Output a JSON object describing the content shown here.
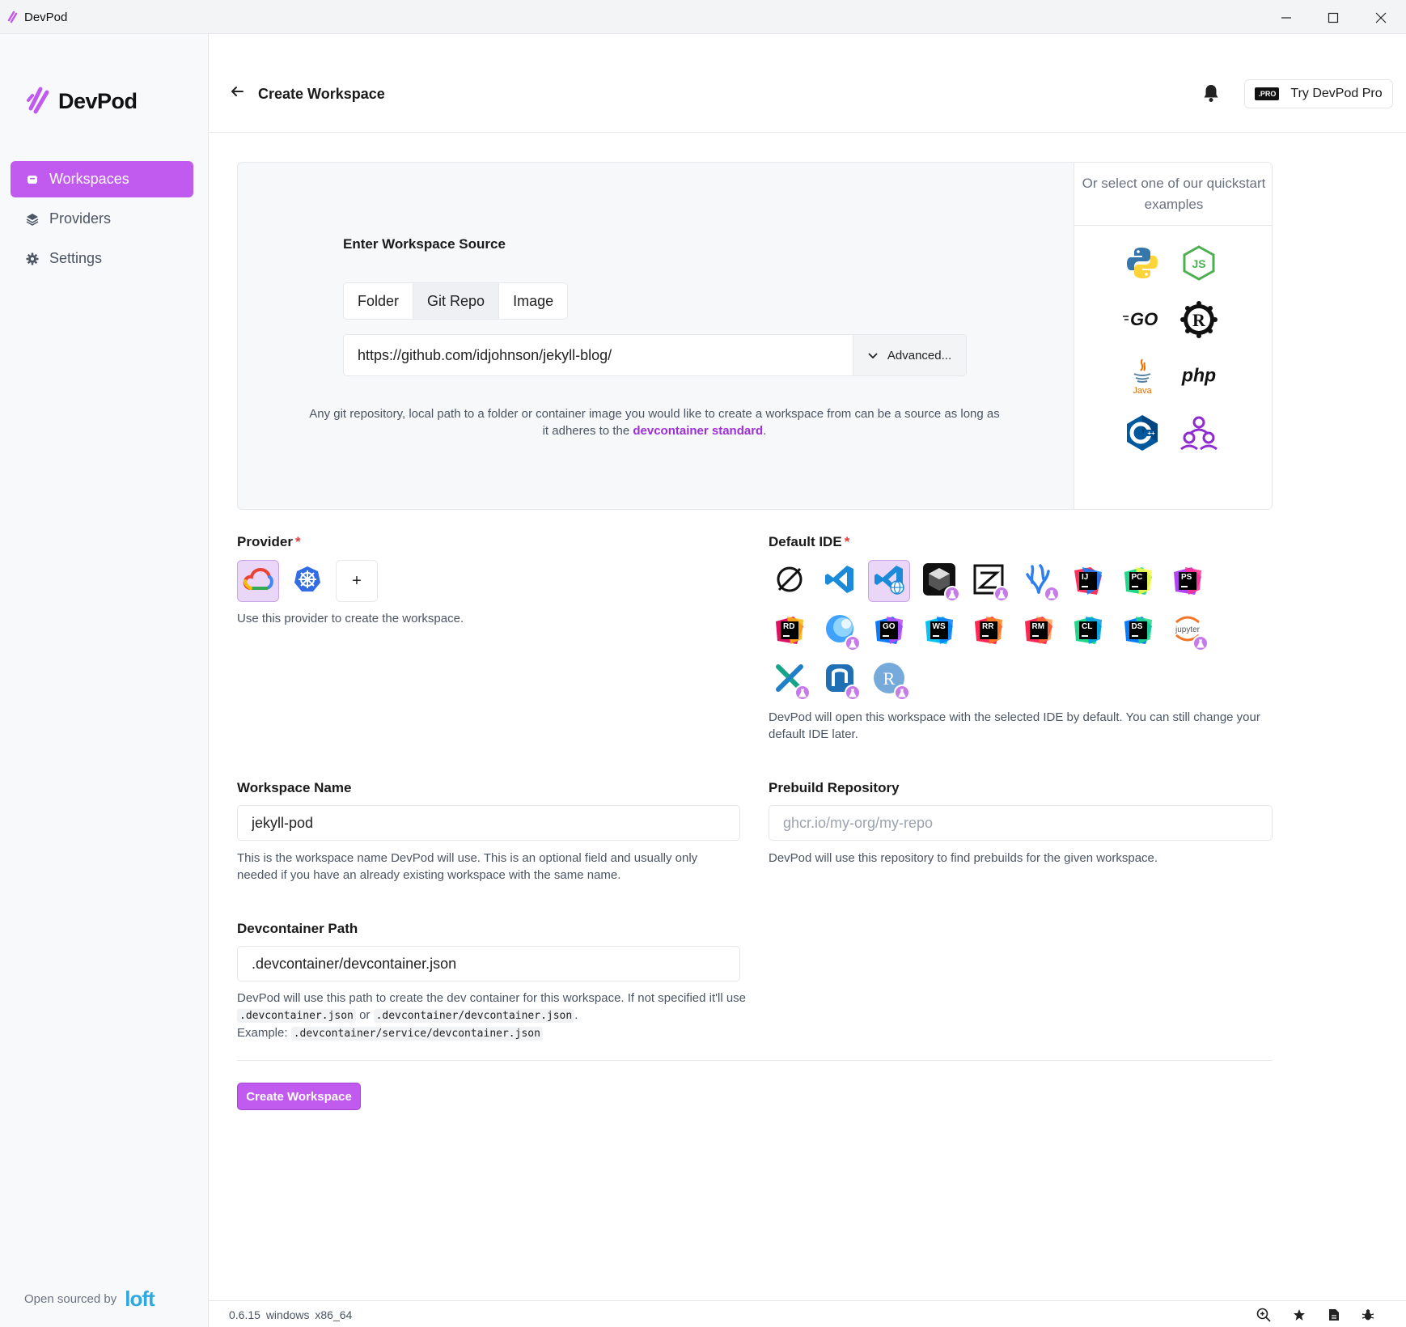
{
  "window": {
    "title": "DevPod"
  },
  "sidebar": {
    "logo_text": "DevPod",
    "items": [
      {
        "label": "Workspaces",
        "icon": "workspaces-icon",
        "active": true
      },
      {
        "label": "Providers",
        "icon": "layers-icon",
        "active": false
      },
      {
        "label": "Settings",
        "icon": "gear-icon",
        "active": false
      }
    ],
    "footer_text": "Open sourced by",
    "footer_brand": "loft"
  },
  "header": {
    "title": "Create Workspace",
    "pro_badge": ".PRO",
    "pro_label": "Try DevPod Pro"
  },
  "source": {
    "heading": "Enter Workspace Source",
    "tabs": [
      "Folder",
      "Git Repo",
      "Image"
    ],
    "selected_tab": "Git Repo",
    "url_value": "https://github.com/idjohnson/jekyll-blog/",
    "advanced_label": "Advanced...",
    "help_prefix": "Any git repository, local path to a folder or container image you would like to create a workspace from can be a source as long as it adheres to the",
    "help_link": "devcontainer standard",
    "help_suffix": "."
  },
  "quickstart": {
    "title": "Or select one of our quickstart examples",
    "items": [
      "python-icon",
      "nodejs-icon",
      "go-icon",
      "rust-icon",
      "java-icon",
      "php-icon",
      "cpp-icon",
      "community-icon"
    ]
  },
  "provider": {
    "label": "Provider",
    "required_mark": "*",
    "help": "Use this provider to create the workspace.",
    "add_label": "+"
  },
  "ide": {
    "label": "Default IDE",
    "required_mark": "*",
    "help": "DevPod will open this workspace with the selected IDE by default. You can still change your default IDE later.",
    "jetbrains": {
      "intellij": "IJ",
      "pycharm": "PC",
      "phpstorm": "PS",
      "rider": "RD",
      "goland": "GO",
      "webstorm": "WS",
      "rustrover": "RR",
      "rubymine": "RM",
      "clion": "CL",
      "dataspell": "DS"
    },
    "jupyter_label": "jupyter",
    "r_label": "R"
  },
  "workspace_name": {
    "label": "Workspace Name",
    "value": "jekyll-pod",
    "help": "This is the workspace name DevPod will use. This is an optional field and usually only needed if you have an already existing workspace with the same name."
  },
  "prebuild": {
    "label": "Prebuild Repository",
    "placeholder": "ghcr.io/my-org/my-repo",
    "help": "DevPod will use this repository to find prebuilds for the given workspace."
  },
  "devcontainer": {
    "label": "Devcontainer Path",
    "value": ".devcontainer/devcontainer.json",
    "help_1": "DevPod will use this path to create the dev container for this workspace. If not specified it'll use",
    "code_1": ".devcontainer.json",
    "or": "or",
    "code_2": ".devcontainer/devcontainer.json",
    "help_2": "Example:",
    "code_3": ".devcontainer/service/devcontainer.json"
  },
  "create_button": "Create Workspace",
  "status": {
    "text": "0.6.15 windows x86_64"
  },
  "colors": {
    "accent": "#c15aef",
    "link": "#9d2fd6",
    "loft": "#2ea9e0"
  }
}
